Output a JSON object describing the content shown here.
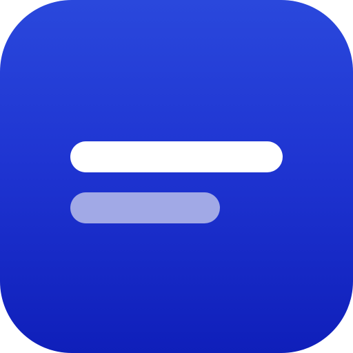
{
  "icon": {
    "name": "text-lines-app-icon",
    "colors": {
      "background_top": "#2a48dc",
      "background_bottom": "#0f1fba",
      "primary_line": "#ffffff",
      "secondary_line": "#a1a9e6"
    },
    "lines": [
      {
        "name": "primary-line"
      },
      {
        "name": "secondary-line"
      }
    ]
  }
}
